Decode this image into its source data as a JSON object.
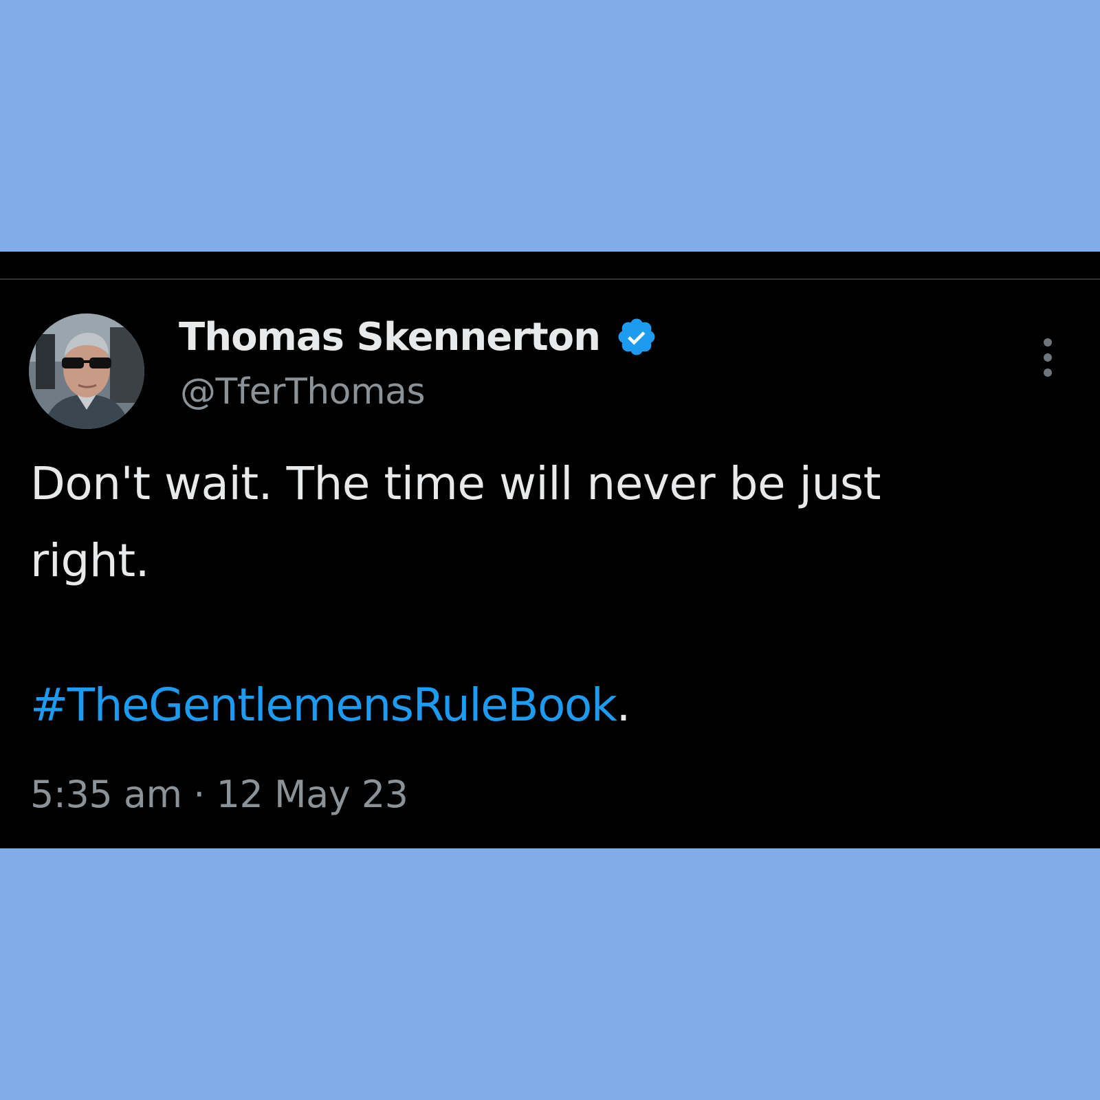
{
  "colors": {
    "page_background": "#82ACE8",
    "card_background": "#000000",
    "primary_text": "#E7E9EA",
    "secondary_text": "#8B9399",
    "accent_blue": "#1D9BF0"
  },
  "tweet": {
    "author": {
      "display_name": "Thomas Skennerton",
      "handle": "@TferThomas",
      "verified": true,
      "verified_icon": "verified-badge-icon",
      "avatar_icon": "profile-photo"
    },
    "more_icon": "more-options-vertical-icon",
    "body_text": "Don't wait. The time will never be just right.",
    "hashtag": "#TheGentlemensRuleBook",
    "hashtag_suffix": ".",
    "time": "5:35 am",
    "separator": "·",
    "date": "12 May 23"
  }
}
